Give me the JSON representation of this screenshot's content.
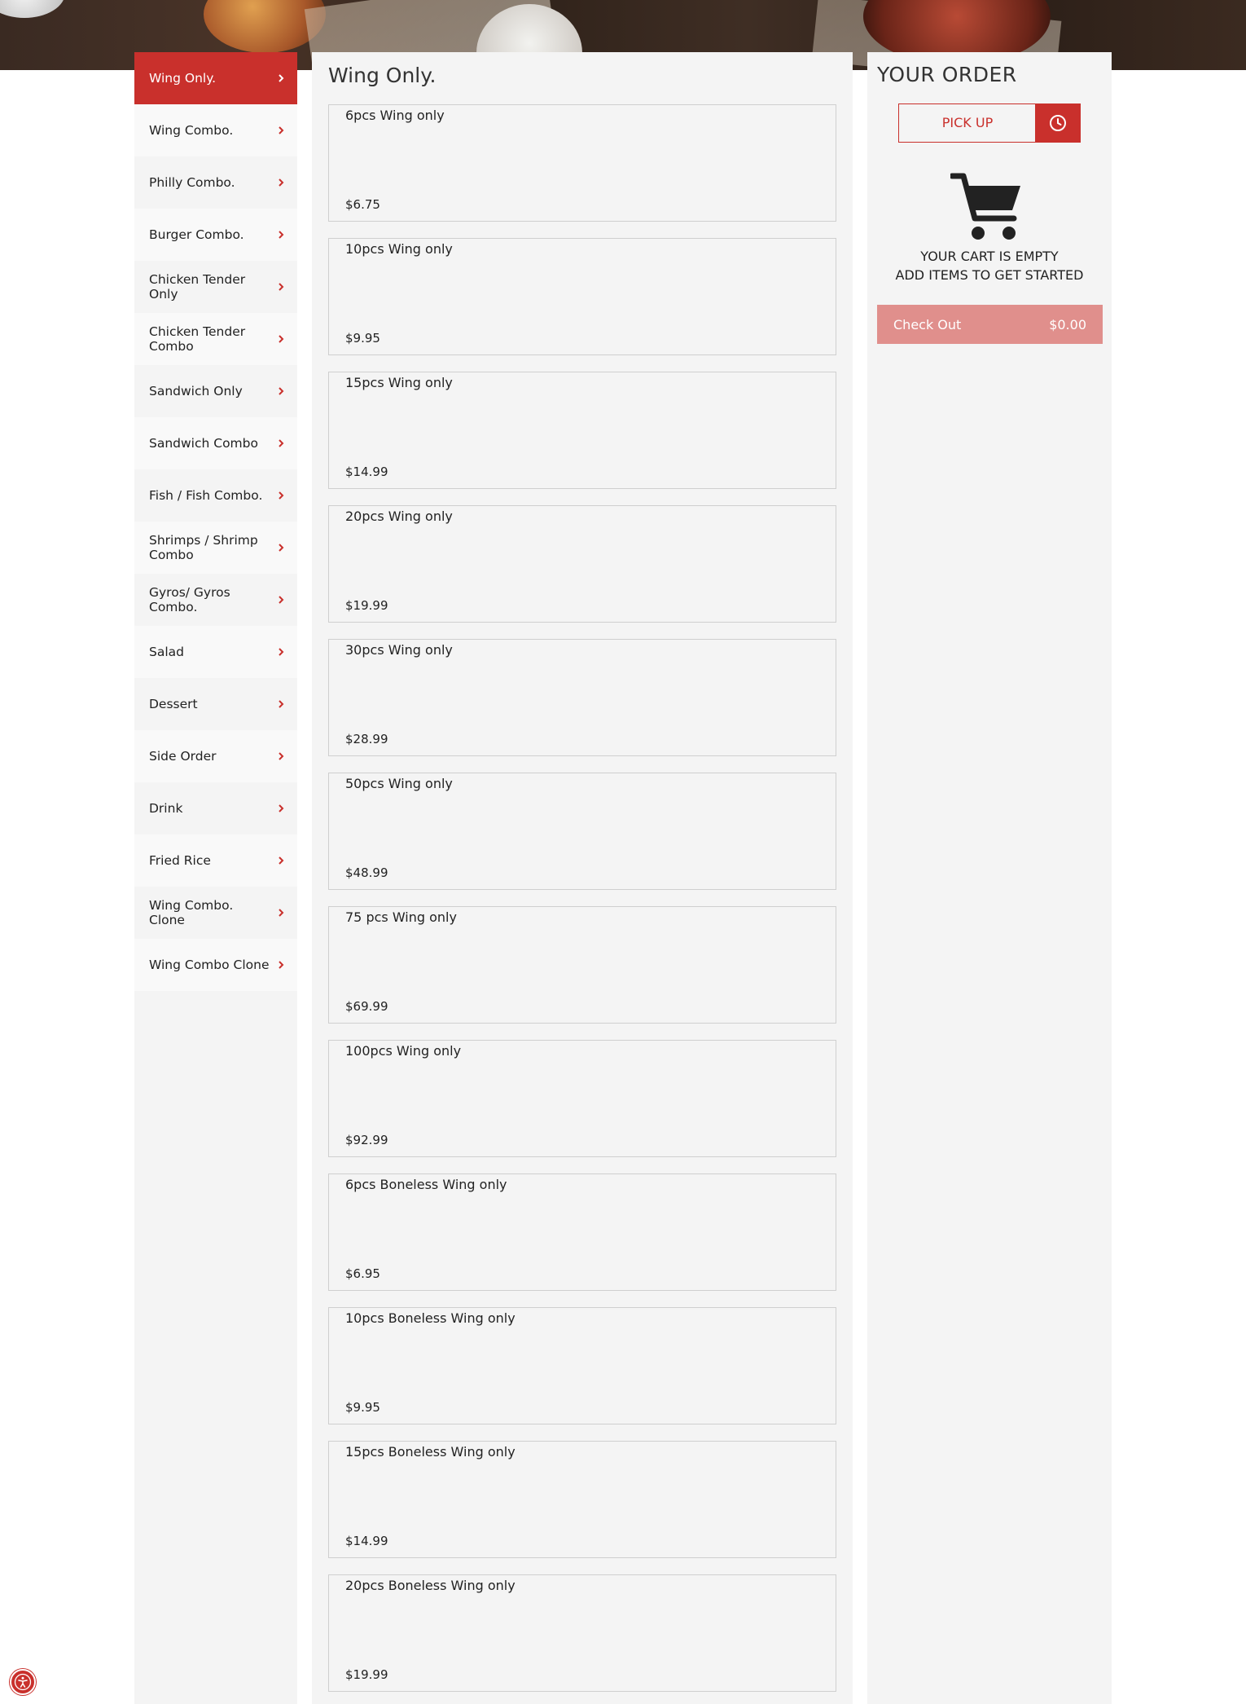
{
  "sidebar": {
    "items": [
      {
        "label": "Wing Only."
      },
      {
        "label": "Wing Combo."
      },
      {
        "label": "Philly Combo."
      },
      {
        "label": "Burger Combo."
      },
      {
        "label": "Chicken Tender Only"
      },
      {
        "label": "Chicken Tender Combo"
      },
      {
        "label": "Sandwich Only"
      },
      {
        "label": "Sandwich Combo"
      },
      {
        "label": "Fish / Fish Combo."
      },
      {
        "label": "Shrimps / Shrimp Combo"
      },
      {
        "label": "Gyros/ Gyros Combo."
      },
      {
        "label": "Salad"
      },
      {
        "label": "Dessert"
      },
      {
        "label": "Side Order"
      },
      {
        "label": "Drink"
      },
      {
        "label": "Fried Rice"
      },
      {
        "label": "Wing Combo. Clone"
      },
      {
        "label": "Wing Combo Clone"
      }
    ],
    "active_label": "Wing Only."
  },
  "main": {
    "title": "Wing Only.",
    "items": [
      {
        "name": "6pcs Wing only",
        "price": "$6.75"
      },
      {
        "name": "10pcs Wing only",
        "price": "$9.95"
      },
      {
        "name": "15pcs Wing only",
        "price": "$14.99"
      },
      {
        "name": "20pcs Wing only",
        "price": "$19.99"
      },
      {
        "name": "30pcs Wing only",
        "price": "$28.99"
      },
      {
        "name": "50pcs Wing only",
        "price": "$48.99"
      },
      {
        "name": "75 pcs Wing only",
        "price": "$69.99"
      },
      {
        "name": "100pcs Wing only",
        "price": "$92.99"
      },
      {
        "name": "6pcs Boneless Wing only",
        "price": "$6.95"
      },
      {
        "name": "10pcs Boneless Wing only",
        "price": "$9.95"
      },
      {
        "name": "15pcs Boneless Wing only",
        "price": "$14.99"
      },
      {
        "name": "20pcs Boneless Wing only",
        "price": "$19.99"
      }
    ]
  },
  "order": {
    "title": "YOUR ORDER",
    "pickup_label": "PICK UP",
    "empty_line1": "YOUR CART IS EMPTY",
    "empty_line2": "ADD ITEMS TO GET STARTED",
    "checkout_label": "Check Out",
    "checkout_total": "$0.00"
  },
  "icons": {
    "chevron": "chevron-right-icon",
    "clock": "clock-icon",
    "cart": "shopping-cart-icon",
    "accessibility": "accessibility-icon"
  },
  "colors": {
    "accent": "#c9302c",
    "checkout_disabled": "#e08f8c",
    "panel_bg": "#f4f4f4"
  }
}
